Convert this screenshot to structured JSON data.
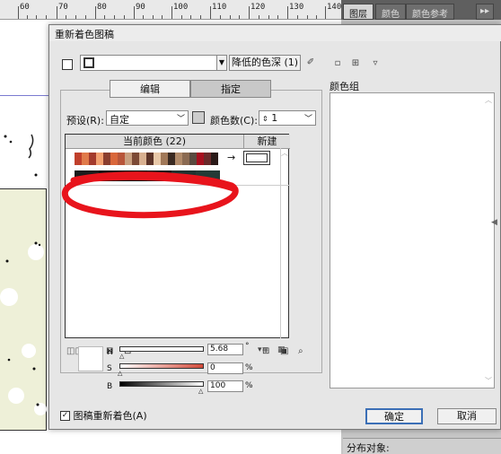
{
  "ruler": {
    "ticks": [
      "60",
      "70",
      "80",
      "90",
      "100",
      "110",
      "120",
      "130",
      "140"
    ]
  },
  "panel_tabs": [
    {
      "label": "图层"
    },
    {
      "label": "颜色"
    },
    {
      "label": "颜色参考"
    },
    {
      "label": "▸▸"
    }
  ],
  "bottom_panel": {
    "distribute_label": "分布对象:"
  },
  "dialog": {
    "title": "重新着色图稿",
    "preset_color_name": "降低的色深 (1)",
    "color_groups_label": "颜色组",
    "tabs": [
      {
        "label": "编辑"
      },
      {
        "label": "指定"
      }
    ],
    "preset_label": "预设(R):",
    "preset_value": "自定",
    "colors_label": "颜色数(C):",
    "colors_value": "1",
    "current_colors_header": "当前颜色 (22)",
    "new_header": "新建",
    "current_swatches": [
      "#c0402c",
      "#e07a4a",
      "#a33a2c",
      "#f2a070",
      "#8a3d2e",
      "#d9673b",
      "#b8563a",
      "#c9a080",
      "#7c4a36",
      "#d8b090",
      "#5d3428",
      "#e8c8a8",
      "#a07858",
      "#3a2a22",
      "#b08a6a",
      "#8a6a52",
      "#5a4a40",
      "#a6101f",
      "#6a2a2a",
      "#2a1a18"
    ],
    "second_row_swatches": [
      "#1c1c1c",
      "#101010",
      "#0c0c0c",
      "#161a1a",
      "#1f3230",
      "#243a36"
    ],
    "arrow": "→",
    "h_label": "H",
    "h_value": "5.68",
    "h_unit": "°",
    "s_label": "S",
    "s_value": "0",
    "s_unit": "%",
    "b_label": "B",
    "b_value": "100",
    "b_unit": "%",
    "recolor_label": "图稿重新着色(A)",
    "ok_label": "确定",
    "cancel_label": "取消"
  },
  "colors": {
    "annotation_red": "#e8141c",
    "swatch_slider_red": "#d24a3a"
  }
}
